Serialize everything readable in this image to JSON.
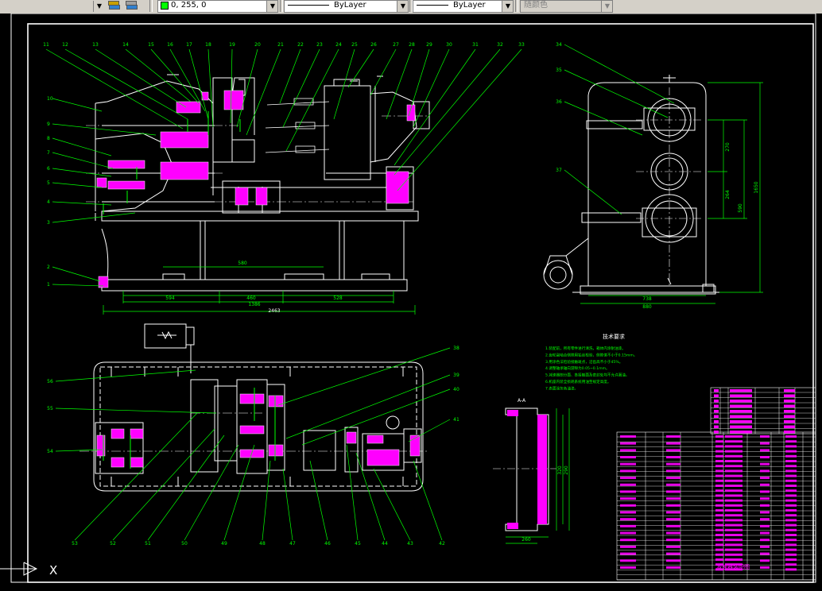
{
  "toolbar": {
    "color_value": "0, 255, 0",
    "linetype": "ByLayer",
    "lineweight": "ByLayer",
    "plotstyle": "随颜色"
  },
  "colors": {
    "background": "#000000",
    "outline": "#ffffff",
    "leader": "#00ff00",
    "hatch": "#ff00ff",
    "dimension": "#00ff00"
  },
  "drawing": {
    "front_view_labels": [
      "11",
      "12",
      "13",
      "14",
      "15",
      "16",
      "17",
      "18",
      "19",
      "20",
      "21",
      "22",
      "23",
      "24",
      "25",
      "26",
      "27",
      "28",
      "29",
      "30",
      "31",
      "32",
      "33"
    ],
    "left_labels": [
      "10",
      "9",
      "8",
      "7",
      "6",
      "5",
      "4",
      "3",
      "2",
      "1"
    ],
    "side_view_labels": [
      "34",
      "35",
      "36",
      "37"
    ],
    "plan_right_labels": [
      "38",
      "39",
      "40",
      "41"
    ],
    "plan_left_labels": [
      "56",
      "55",
      "54"
    ],
    "plan_bottom_labels": [
      "53",
      "52",
      "51",
      "50",
      "49",
      "48",
      "47",
      "46",
      "45",
      "44",
      "43",
      "42"
    ],
    "dims": {
      "d1": "580",
      "d2": "594",
      "d3": "460",
      "d4": "528",
      "d5": "1386",
      "d6": "2463",
      "s1": "270",
      "s2": "264",
      "s3": "590",
      "s4": "1650",
      "s5": "738",
      "s6": "880",
      "section_title": "A-A",
      "sec_d1": "320",
      "sec_d2": "290",
      "sec_d3": "260"
    },
    "tech_title": "技术要求",
    "tech_lines": [
      "1.装配前，所有零件进行清洗，箱体内涂耐油漆。",
      "2.齿轮副啮合侧隙用铅丝检验，侧隙值不小于0.15mm。",
      "3.用涂色法检验接触斑点，沿齿高不小于45%。",
      "4.调整轴承轴向游隙为0.05~0.1mm。",
      "5.减速器剖分面、各接触面及密封处均不允许漏油。",
      "6.机座内装全损耗系统用油至规定高度。",
      "7.表面涂灰色油漆。"
    ],
    "title_block": "减速器装配图"
  },
  "ucs": {
    "x_label": "X"
  }
}
